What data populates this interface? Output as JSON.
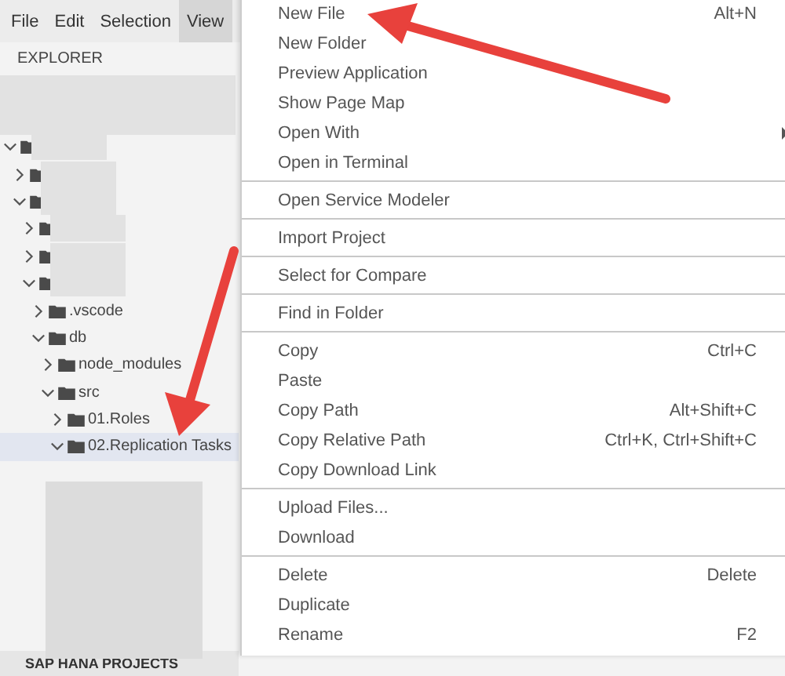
{
  "menubar": [
    {
      "label": "File",
      "selected": false
    },
    {
      "label": "Edit",
      "selected": false
    },
    {
      "label": "Selection",
      "selected": false
    },
    {
      "label": "View",
      "selected": true
    }
  ],
  "explorer": {
    "title": "EXPLORER",
    "tree": [
      {
        "expanded": true,
        "selected": false,
        "children": [
          {
            "expanded": false,
            "selected": false
          },
          {
            "expanded": true,
            "selected": false,
            "children": [
              {
                "expanded": false,
                "selected": false
              },
              {
                "expanded": false,
                "selected": false
              },
              {
                "expanded": true,
                "selected": false,
                "children": [
                  {
                    "label": ".vscode",
                    "expanded": false,
                    "selected": false
                  },
                  {
                    "label": "db",
                    "expanded": true,
                    "selected": false,
                    "children": [
                      {
                        "label": "node_modules",
                        "expanded": false,
                        "selected": false
                      },
                      {
                        "label": "src",
                        "expanded": true,
                        "selected": false,
                        "children": [
                          {
                            "label": "01.Roles",
                            "expanded": false,
                            "selected": false
                          },
                          {
                            "label": "02.Replication Tasks",
                            "expanded": true,
                            "selected": true
                          }
                        ]
                      }
                    ]
                  }
                ]
              }
            ]
          }
        ]
      }
    ],
    "footer_section": "SAP HANA PROJECTS"
  },
  "context_menu": [
    [
      {
        "label": "New File",
        "shortcut": "Alt+N"
      },
      {
        "label": "New Folder"
      },
      {
        "label": "Preview Application"
      },
      {
        "label": "Show Page Map"
      },
      {
        "label": "Open With",
        "submenu": true
      },
      {
        "label": "Open in Terminal"
      }
    ],
    [
      {
        "label": "Open Service Modeler"
      }
    ],
    [
      {
        "label": "Import Project"
      }
    ],
    [
      {
        "label": "Select for Compare"
      }
    ],
    [
      {
        "label": "Find in Folder"
      }
    ],
    [
      {
        "label": "Copy",
        "shortcut": "Ctrl+C"
      },
      {
        "label": "Paste"
      },
      {
        "label": "Copy Path",
        "shortcut": "Alt+Shift+C"
      },
      {
        "label": "Copy Relative Path",
        "shortcut": "Ctrl+K, Ctrl+Shift+C"
      },
      {
        "label": "Copy Download Link"
      }
    ],
    [
      {
        "label": "Upload Files..."
      },
      {
        "label": "Download"
      }
    ],
    [
      {
        "label": "Delete",
        "shortcut": "Delete"
      },
      {
        "label": "Duplicate"
      },
      {
        "label": "Rename",
        "shortcut": "F2"
      }
    ]
  ]
}
